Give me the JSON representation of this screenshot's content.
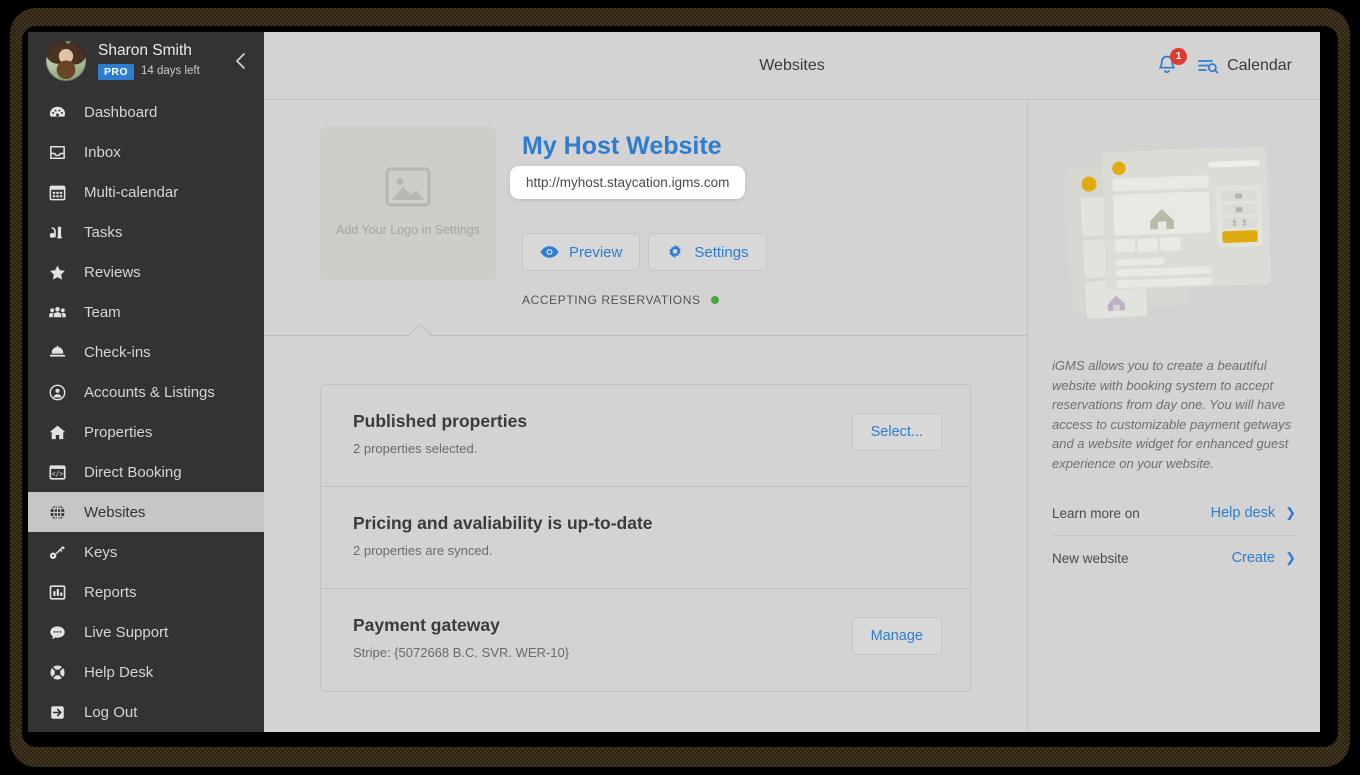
{
  "sidebar": {
    "profile": {
      "name": "Sharon Smith",
      "badge": "PRO",
      "trial": "14 days left",
      "collapse_icon": "chevron-left-icon"
    },
    "items": [
      {
        "label": "Dashboard",
        "icon": "dashboard-icon",
        "active": false
      },
      {
        "label": "Inbox",
        "icon": "inbox-icon",
        "active": false
      },
      {
        "label": "Multi-calendar",
        "icon": "calendar-icon",
        "active": false
      },
      {
        "label": "Tasks",
        "icon": "tasks-icon",
        "active": false
      },
      {
        "label": "Reviews",
        "icon": "star-icon",
        "active": false
      },
      {
        "label": "Team",
        "icon": "users-icon",
        "active": false
      },
      {
        "label": "Check-ins",
        "icon": "bell-desk-icon",
        "active": false
      },
      {
        "label": "Accounts & Listings",
        "icon": "user-circle-icon",
        "active": false
      },
      {
        "label": "Properties",
        "icon": "home-icon",
        "active": false
      },
      {
        "label": "Direct Booking",
        "icon": "code-window-icon",
        "active": false
      },
      {
        "label": "Websites",
        "icon": "globe-icon",
        "active": true
      },
      {
        "label": "Keys",
        "icon": "key-icon",
        "active": false
      },
      {
        "label": "Reports",
        "icon": "bar-chart-icon",
        "active": false
      },
      {
        "label": "Live Support",
        "icon": "chat-icon",
        "active": false
      },
      {
        "label": "Help Desk",
        "icon": "lifebuoy-icon",
        "active": false
      },
      {
        "label": "Log Out",
        "icon": "logout-icon",
        "active": false
      }
    ]
  },
  "topbar": {
    "title": "Websites",
    "notifications_count": "1",
    "notifications_icon": "bell-icon",
    "calendar_label": "Calendar",
    "calendar_icon": "list-search-icon"
  },
  "site": {
    "logo_placeholder": "Add Your Logo in Settings",
    "logo_icon": "image-placeholder-icon",
    "title": "My Host Website",
    "url": "http://myhost.staycation.igms.com",
    "preview_label": "Preview",
    "preview_icon": "eye-icon",
    "settings_label": "Settings",
    "settings_icon": "gear-icon",
    "status_label": "ACCEPTING RESERVATIONS",
    "status_color": "#46a845"
  },
  "cards": [
    {
      "title": "Published properties",
      "subtitle": "2 properties selected.",
      "action": "Select..."
    },
    {
      "title": "Pricing and avaliability is up-to-date",
      "subtitle": "2 properties are synced.",
      "action": ""
    },
    {
      "title": "Payment gateway",
      "subtitle": "Stripe: {5072668 B.C. SVR. WER-10}",
      "action": "Manage"
    }
  ],
  "right_panel": {
    "illustration": "website-mockup-illustration",
    "promo": "iGMS allows you to create a beautiful website with booking system to accept reservations from day one. You will have access to customizable payment getways and a website widget for enhanced guest experience on your website.",
    "rows": [
      {
        "label": "Learn more on",
        "link": "Help desk",
        "chevron": "chevron-right-icon"
      },
      {
        "label": "New website",
        "link": "Create",
        "chevron": "chevron-right-icon"
      }
    ]
  },
  "colors": {
    "accent_blue": "#2e7dd1",
    "sidebar_bg": "#333333",
    "app_bg": "#d3d3d3",
    "badge_red": "#e03a30",
    "status_green": "#46a845",
    "illustration_yellow": "#e0ab0f"
  }
}
